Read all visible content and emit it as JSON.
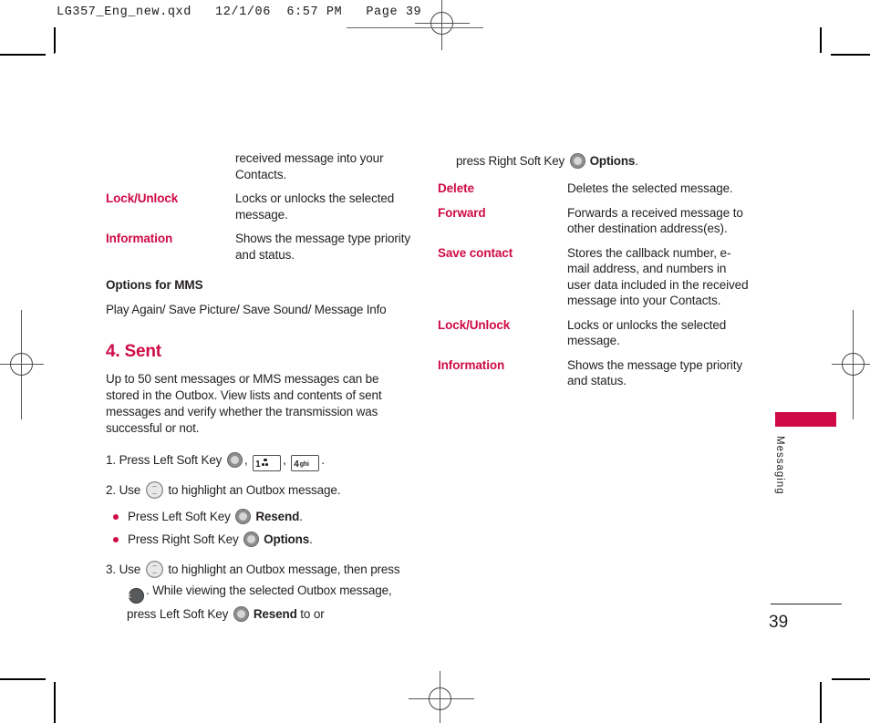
{
  "print_header": {
    "text": "LG357_Eng_new.qxd   12/1/06  6:57 PM   Page 39"
  },
  "colors": {
    "accent": "#cf0a46",
    "body_text": "#231f20",
    "key_gray": "#8e8e8e",
    "ok_key": "#58595b"
  },
  "left_column": {
    "continued_desc": "received message into your Contacts.",
    "definitions": [
      {
        "term": "Lock/Unlock",
        "desc": "Locks or unlocks the selected message."
      },
      {
        "term": "Information",
        "desc": "Shows the message type priority and status."
      }
    ],
    "mms_heading": "Options for MMS",
    "mms_options_line": "Play Again/ Save Picture/ Save Sound/ Message Info",
    "section_title": "4. Sent",
    "section_body": "Up to 50 sent messages or MMS messages can be stored in the Outbox. View lists and contents of sent messages and verify whether the transmission was successful or not.",
    "steps": [
      {
        "number": "1.",
        "parts": [
          "Press Left Soft Key ",
          ", ",
          ", ",
          "."
        ],
        "keys": [
          "soft-key-icon",
          "key-1-voicemail-icon",
          "key-4-ghi-icon"
        ]
      },
      {
        "number": "2.",
        "before": "Use ",
        "after": " to highlight an Outbox message.",
        "key": "navigation-key-icon"
      }
    ],
    "bullets": [
      {
        "before": "Press Left Soft Key ",
        "key": "soft-key-icon",
        "bold": "Resend",
        "after": "."
      },
      {
        "before": "Press Right Soft Key ",
        "key": "soft-key-icon",
        "bold": "Options",
        "after": "."
      }
    ],
    "step3": {
      "number": "3.",
      "t1": "Use ",
      "t2": " to highlight an Outbox message, then press ",
      "t3": ". While viewing the selected Outbox message, press Left Soft Key ",
      "bold": "Resend",
      "t4": " to or"
    }
  },
  "right_column": {
    "continued_line": {
      "before": "press Right Soft Key ",
      "bold": "Options",
      "after": "."
    },
    "definitions": [
      {
        "term": "Delete",
        "desc": "Deletes the selected message."
      },
      {
        "term": "Forward",
        "desc": "Forwards a received message to other destination address(es)."
      },
      {
        "term": "Save contact",
        "desc": "Stores the callback number, e-mail address, and numbers in user data included in the received message into your Contacts."
      },
      {
        "term": "Lock/Unlock",
        "desc": "Locks or unlocks the selected message."
      },
      {
        "term": "Information",
        "desc": "Shows the message type priority and status."
      }
    ]
  },
  "side_tab": {
    "label": "Messaging"
  },
  "folio": {
    "page_number": "39"
  }
}
